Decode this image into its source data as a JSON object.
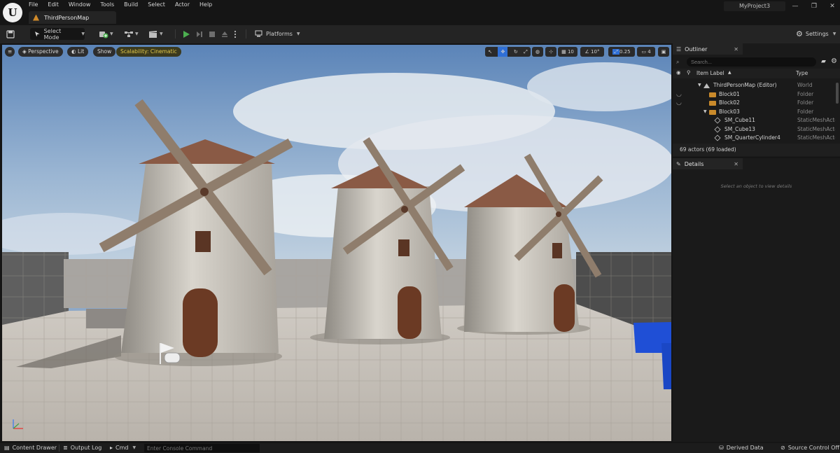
{
  "app": {
    "menu": [
      "File",
      "Edit",
      "Window",
      "Tools",
      "Build",
      "Select",
      "Actor",
      "Help"
    ],
    "map_tab": "ThirdPersonMap",
    "project": "MyProject3",
    "window_controls": [
      "—",
      "❐",
      "✕"
    ]
  },
  "toolbar": {
    "select_mode": "Select Mode",
    "platforms": "Platforms",
    "settings": "Settings"
  },
  "viewport": {
    "perspective": "Perspective",
    "lit": "Lit",
    "show": "Show",
    "scalability": "Scalability: Cinematic",
    "grid_snap": "10",
    "rotation_snap": "10°",
    "scale_snap": "0.25",
    "camera_speed": "4"
  },
  "outliner": {
    "tab": "Outliner",
    "search_placeholder": "Search...",
    "col_label": "Item Label",
    "col_type": "Type",
    "rows": [
      {
        "label": "ThirdPersonMap (Editor)",
        "type": "World"
      },
      {
        "label": "Block01",
        "type": "Folder"
      },
      {
        "label": "Block02",
        "type": "Folder"
      },
      {
        "label": "Block03",
        "type": "Folder"
      },
      {
        "label": "SM_Cube11",
        "type": "StaticMeshActor"
      },
      {
        "label": "SM_Cube13",
        "type": "StaticMeshActor"
      },
      {
        "label": "SM_QuarterCylinder4",
        "type": "StaticMeshActor"
      }
    ],
    "actor_count": "69 actors (69 loaded)"
  },
  "details": {
    "tab": "Details",
    "empty_message": "Select an object to view details"
  },
  "statusbar": {
    "content_drawer": "Content Drawer",
    "output_log": "Output Log",
    "cmd": "Cmd",
    "console_placeholder": "Enter Console Command",
    "derived_data": "Derived Data",
    "source_control": "Source Control Off"
  },
  "colors": {
    "accent_play": "#4caf50",
    "folder": "#c98a2b",
    "scalability_text": "#e2c84a",
    "selected_tool": "#2f6fd6"
  }
}
